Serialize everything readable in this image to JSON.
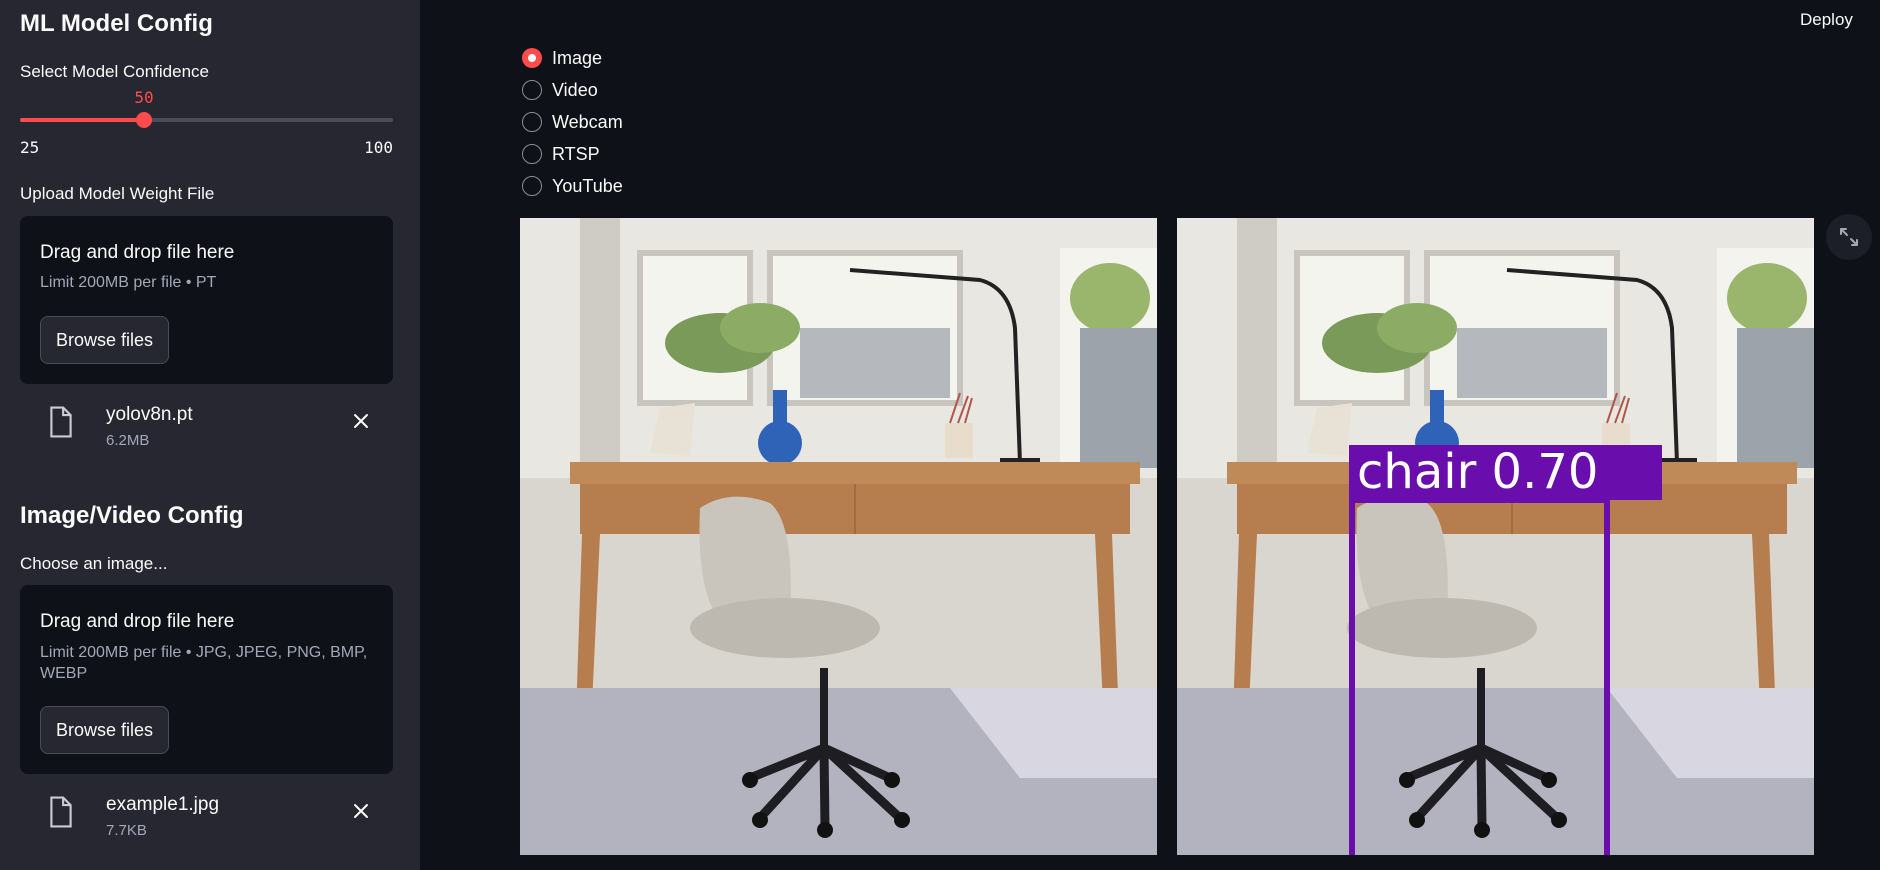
{
  "sidebar": {
    "model_section_title": "ML Model Config",
    "confidence": {
      "label": "Select Model Confidence",
      "value": 50,
      "value_text": "50",
      "min": 25,
      "max": 100,
      "min_text": "25",
      "max_text": "100"
    },
    "weight_upload": {
      "label": "Upload Model Weight File",
      "drop_title": "Drag and drop file here",
      "limit_text": "Limit 200MB per file • PT",
      "browse_label": "Browse files",
      "file": {
        "name": "yolov8n.pt",
        "size": "6.2MB"
      }
    },
    "media_section_title": "Image/Video Config",
    "image_upload": {
      "label": "Choose an image...",
      "drop_title": "Drag and drop file here",
      "limit_text": "Limit 200MB per file • JPG, JPEG, PNG, BMP, WEBP",
      "browse_label": "Browse files",
      "file": {
        "name": "example1.jpg",
        "size": "7.7KB"
      }
    }
  },
  "header": {
    "deploy_label": "Deploy"
  },
  "source_options": [
    {
      "label": "Image",
      "selected": true
    },
    {
      "label": "Video",
      "selected": false
    },
    {
      "label": "Webcam",
      "selected": false
    },
    {
      "label": "RTSP",
      "selected": false
    },
    {
      "label": "YouTube",
      "selected": false
    }
  ],
  "detection": {
    "label": "chair 0.70",
    "box_color": "#6a0dad"
  },
  "colors": {
    "accent": "#ff4b4b",
    "sidebar_bg": "#262730",
    "main_bg": "#0e1117"
  }
}
